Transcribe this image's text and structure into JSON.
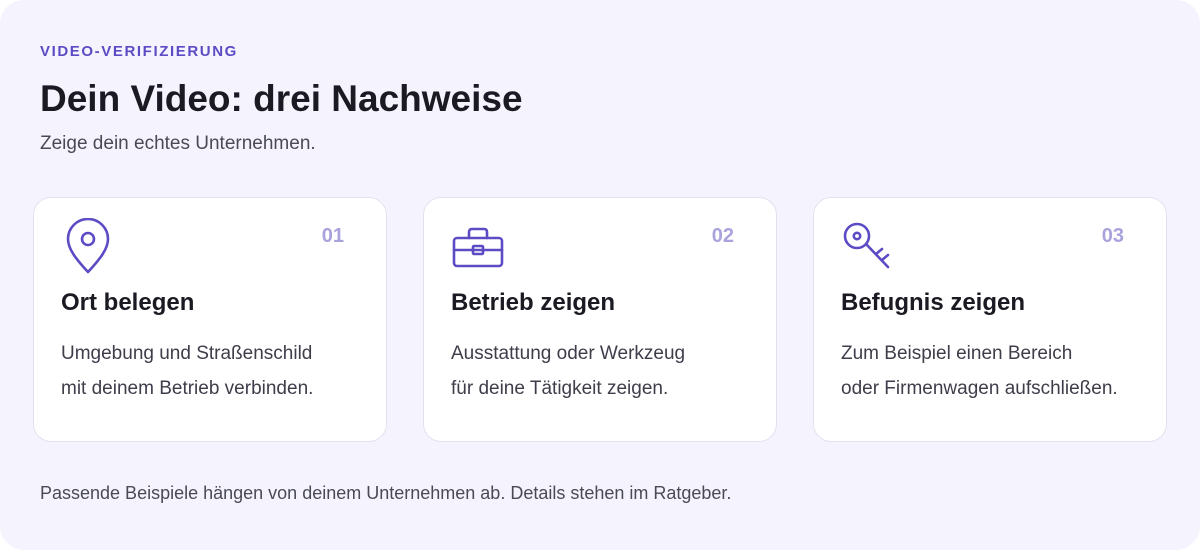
{
  "header": {
    "eyebrow": "VIDEO-VERIFIZIERUNG",
    "title": "Dein Video: drei Nachweise",
    "subtitle": "Zeige dein echtes Unternehmen."
  },
  "cards": [
    {
      "number": "01",
      "icon": "location-pin-icon",
      "title": "Ort belegen",
      "text_lines": [
        "Umgebung und Straßenschild",
        "mit deinem Betrieb verbinden."
      ]
    },
    {
      "number": "02",
      "icon": "briefcase-icon",
      "title": "Betrieb zeigen",
      "text_lines": [
        "Ausstattung oder Werkzeug",
        "für deine Tätigkeit zeigen."
      ]
    },
    {
      "number": "03",
      "icon": "key-icon",
      "title": "Befugnis zeigen",
      "text_lines": [
        "Zum Beispiel einen Bereich",
        "oder Firmenwagen aufschließen."
      ]
    }
  ],
  "footnote": "Passende Beispiele hängen von deinem Unternehmen ab. Details stehen im Ratgeber.",
  "colors": {
    "accent": "#5b4bc4",
    "number": "#a9a3dc",
    "panel_bg": "#f5f4fe",
    "card_bg": "#ffffff"
  }
}
